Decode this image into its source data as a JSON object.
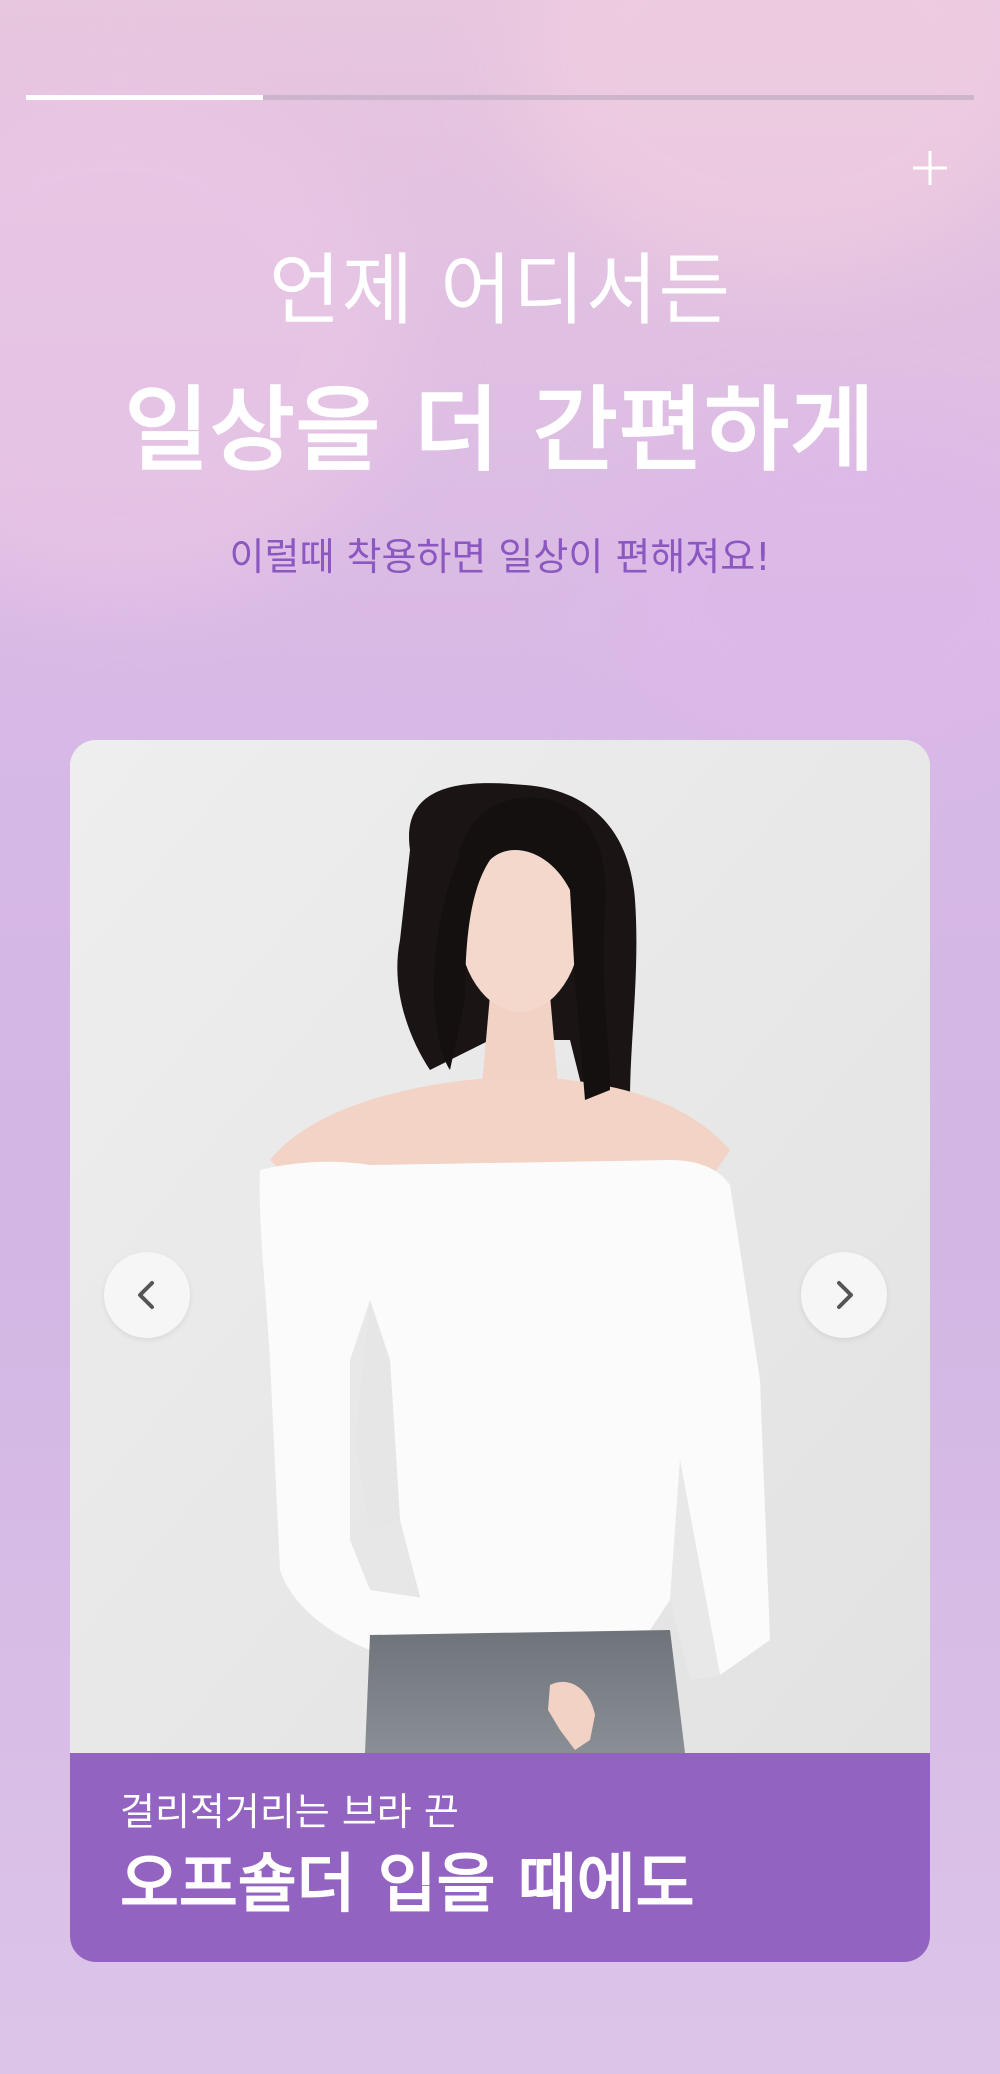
{
  "progress": {
    "fraction": 0.25
  },
  "heading": {
    "line1": "언제 어디서든",
    "line2": "일상을 더 간편하게",
    "sub": "이럴때 착용하면 일상이 편해져요!"
  },
  "slide": {
    "caption_small": "걸리적거리는 브라 끈",
    "caption_big": "오프숄더 입을 때에도"
  },
  "icons": {
    "close": "plus-icon",
    "prev": "chevron-left-icon",
    "next": "chevron-right-icon"
  },
  "colors": {
    "accent": "#9363c1",
    "subheading": "#8b57c0",
    "progress_fill": "#ffffff",
    "progress_track": "#c8b2c8"
  }
}
